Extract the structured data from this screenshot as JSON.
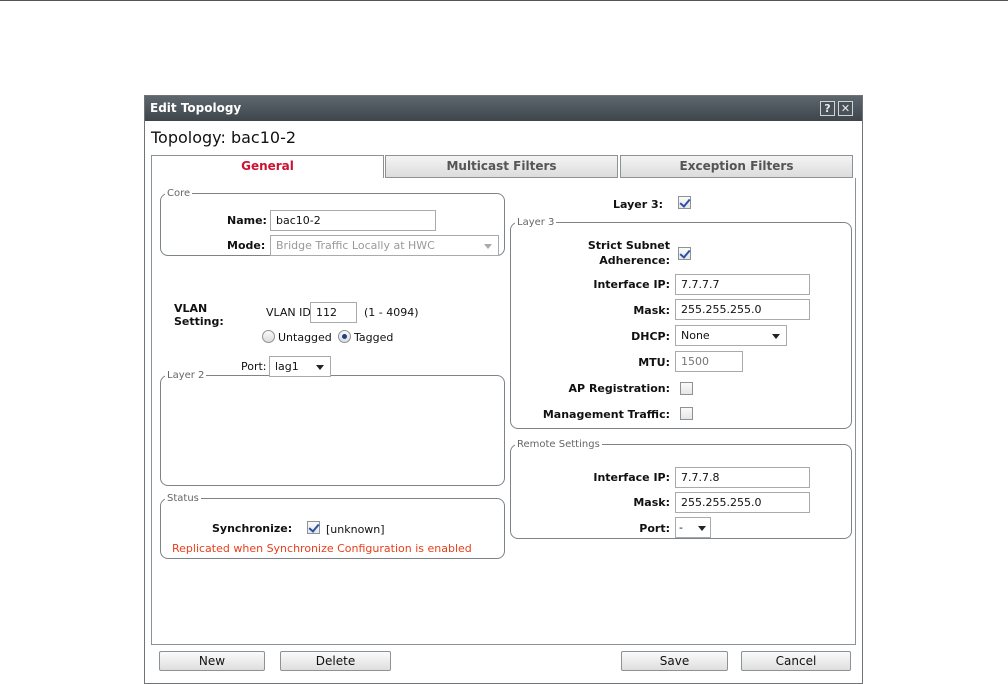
{
  "dialog": {
    "title": "Edit Topology",
    "heading": "Topology: bac10-2",
    "help_label": "?",
    "close_label": "✕"
  },
  "tabs": [
    {
      "label": "General",
      "active": true
    },
    {
      "label": "Multicast Filters",
      "active": false
    },
    {
      "label": "Exception Filters",
      "active": false
    }
  ],
  "core": {
    "legend": "Core",
    "name_label": "Name:",
    "name_value": "bac10-2",
    "mode_label": "Mode:",
    "mode_value": "Bridge Traffic Locally at HWC"
  },
  "layer2": {
    "legend": "Layer 2",
    "vlan_setting_label": "VLAN Setting:",
    "vlan_id_label": "VLAN ID:",
    "vlan_id_value": "112",
    "vlan_range": "(1 - 4094)",
    "untagged_label": "Untagged",
    "tagged_label": "Tagged",
    "tagging": "Tagged",
    "port_label": "Port:",
    "port_value": "lag1"
  },
  "status": {
    "legend": "Status",
    "synchronize_label": "Synchronize:",
    "synchronize_checked": true,
    "synchronize_state": "[unknown]",
    "note": "Replicated when Synchronize Configuration is enabled"
  },
  "layer3_toggle": {
    "label": "Layer 3:",
    "checked": true
  },
  "layer3": {
    "legend": "Layer 3",
    "strict_subnet_label": "Strict Subnet Adherence:",
    "strict_subnet_checked": true,
    "interface_ip_label": "Interface IP:",
    "interface_ip_value": "7.7.7.7",
    "mask_label": "Mask:",
    "mask_value": "255.255.255.0",
    "dhcp_label": "DHCP:",
    "dhcp_value": "None",
    "mtu_label": "MTU:",
    "mtu_placeholder": "1500",
    "ap_registration_label": "AP Registration:",
    "ap_registration_checked": false,
    "management_traffic_label": "Management Traffic:",
    "management_traffic_checked": false
  },
  "remote": {
    "legend": "Remote Settings",
    "interface_ip_label": "Interface IP:",
    "interface_ip_value": "7.7.7.8",
    "mask_label": "Mask:",
    "mask_value": "255.255.255.0",
    "port_label": "Port:",
    "port_value": "-"
  },
  "buttons": {
    "new": "New",
    "delete": "Delete",
    "save": "Save",
    "cancel": "Cancel"
  }
}
